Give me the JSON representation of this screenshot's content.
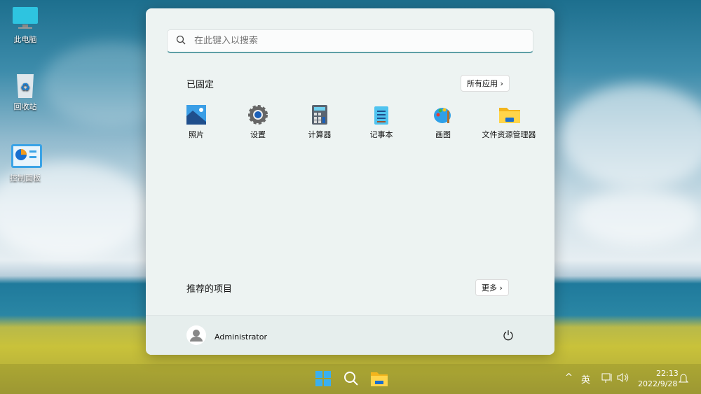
{
  "desktop": {
    "icons": [
      {
        "label": "此电脑"
      },
      {
        "label": "回收站"
      },
      {
        "label": "控制面板"
      }
    ]
  },
  "start_menu": {
    "search_placeholder": "在此键入以搜索",
    "pinned_title": "已固定",
    "all_apps_label": "所有应用",
    "pinned": [
      {
        "label": "照片",
        "icon": "photos-icon"
      },
      {
        "label": "设置",
        "icon": "settings-gear-icon"
      },
      {
        "label": "计算器",
        "icon": "calculator-icon"
      },
      {
        "label": "记事本",
        "icon": "notepad-icon"
      },
      {
        "label": "画图",
        "icon": "paint-icon"
      },
      {
        "label": "文件资源管理器",
        "icon": "file-explorer-icon"
      }
    ],
    "recommended_title": "推荐的项目",
    "more_label": "更多",
    "user_name": "Administrator"
  },
  "tray": {
    "ime": "英",
    "time": "22:13",
    "date": "2022/9/28"
  }
}
